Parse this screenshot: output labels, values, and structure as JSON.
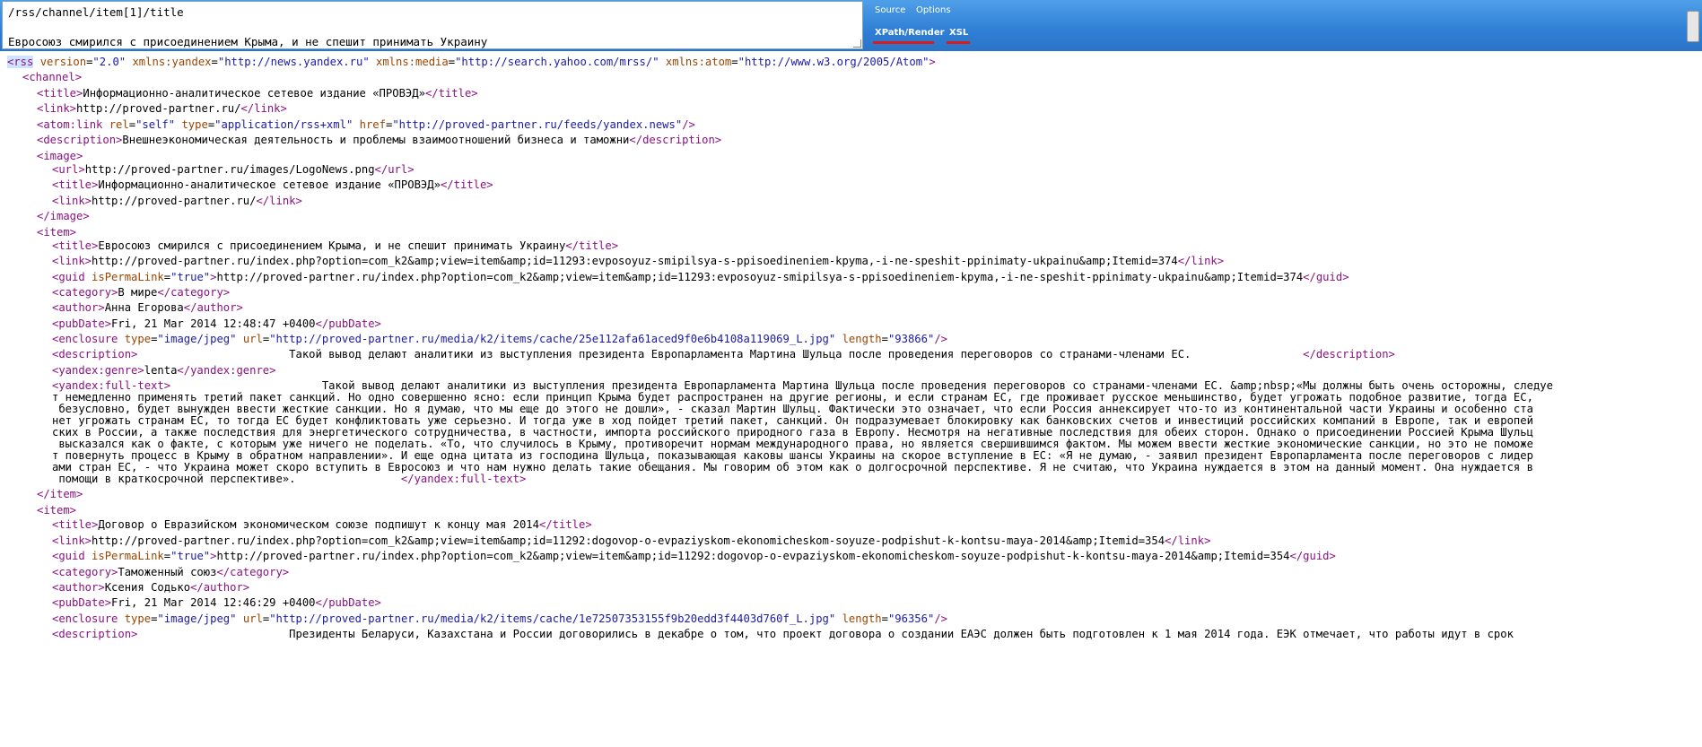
{
  "toolbar": {
    "xpath_query": "/rss/channel/item[1]/title",
    "xpath_result": "Евросоюз смирился с присоединением Крыма, и не спешит принимать Украину",
    "links": {
      "source": "Source",
      "options": "Options"
    },
    "tabs": {
      "xpath": "XPath/Render",
      "xsl": "XSL"
    }
  },
  "rss": {
    "version": "2.0",
    "ns_yandex": "http://news.yandex.ru",
    "ns_media": "http://search.yahoo.com/mrss/",
    "ns_atom": "http://www.w3.org/2005/Atom"
  },
  "channel": {
    "title": "Информационно-аналитическое сетевое издание «ПРОВЭД»",
    "link": "http://proved-partner.ru/",
    "atom_rel": "self",
    "atom_type": "application/rss+xml",
    "atom_href": "http://proved-partner.ru/feeds/yandex.news",
    "description": "Внешнеэкономическая деятельность и проблемы взаимоотношений бизнеса и таможни",
    "image": {
      "url": "http://proved-partner.ru/images/LogoNews.png",
      "title": "Информационно-аналитическое сетевое издание «ПРОВЭД»",
      "link": "http://proved-partner.ru/"
    }
  },
  "items": [
    {
      "title": "Евросоюз смирился с присоединением Крыма, и не спешит принимать Украину",
      "link": "http://proved-partner.ru/index.php?option=com_k2&amp;view=item&amp;id=11293:evposoyuz-smipilsya-s-ppisoedineniem-kpyma,-i-ne-speshit-ppinimaty-ukpainu&amp;Itemid=374",
      "guid_permalink": "true",
      "guid": "http://proved-partner.ru/index.php?option=com_k2&amp;view=item&amp;id=11293:evposoyuz-smipilsya-s-ppisoedineniem-kpyma,-i-ne-speshit-ppinimaty-ukpainu&amp;Itemid=374",
      "category": "В мире",
      "author": "Анна Егорова",
      "pubDate": "Fri, 21 Mar 2014 12:48:47 +0400",
      "enc_type": "image/jpeg",
      "enc_url": "http://proved-partner.ru/media/k2/items/cache/25e112afa61aced9f0e6b4108a119069_L.jpg",
      "enc_length": "93866",
      "description": "                       Такой вывод делают аналитики из выступления президента Европарламента Мартина Шульца после проведения переговоров со странами-членами ЕС.                 ",
      "fulltext_lines": [
        "                       Такой вывод делают аналитики из выступления президента Европарламента Мартина Шульца после проведения переговоров со странами-членами ЕС. &amp;nbsp;«Мы должны быть очень осторожны, следуе",
        "т немедленно применять третий пакет санкций. Но одно совершенно ясно: если принцип Крыма будет распространен на другие регионы, и если странам ЕС, где проживает русское меньшинство, будет угрожать подобное развитие, тогда ЕС,",
        " безусловно, будет вынужден ввести жесткие санкции. Но я думаю, что мы еще до этого не дошли», - сказал Мартин Шульц. Фактически это означает, что если Россия аннексирует что-то из континентальной части Украины и особенно ста",
        "нет угрожать странам ЕС, то тогда ЕС будет конфликтовать уже серьезно. И тогда уже в ход пойдет третий пакет, санкций. Он подразумевает блокировку как банковских счетов и инвестиций российских компаний в Европе, так и европей",
        "ских в России, а также последствия для энергетического сотрудничества, в частности, импорта российского природного газа в Европу. Несмотря на негативные последствия для обеих сторон. Однако о присоединении Россией Крыма Шульц",
        " высказался как о факте, с которым уже ничего не поделать. «То, что случилось в Крыму, противоречит нормам международного права, но является свершившимся фактом. Мы можем ввести жесткие экономические санкции, но это не поможе",
        "т повернуть процесс в Крыму в обратном направлении». И еще одна цитата из господина Шульца, показывающая каковы шансы Украины на скорое вступление в ЕС: «Я не думаю, - заявил президент Европарламента после переговоров с лидер",
        "ами стран ЕС, - что Украина может скоро вступить в Евросоюз и что нам нужно делать такие обещания. Мы говорим об этом как о долгосрочной перспективе. Я не считаю, что Украина нуждается в этом на данный момент. Она нуждается в",
        " помощи в краткосрочной перспективе».                "
      ]
    },
    {
      "title": "Договор о Евразийском экономическом союзе подпишут к концу мая 2014",
      "link": "http://proved-partner.ru/index.php?option=com_k2&amp;view=item&amp;id=11292:dogovop-o-evpaziyskom-ekonomicheskom-soyuze-podpishut-k-kontsu-maya-2014&amp;Itemid=354",
      "guid_permalink": "true",
      "guid": "http://proved-partner.ru/index.php?option=com_k2&amp;view=item&amp;id=11292:dogovop-o-evpaziyskom-ekonomicheskom-soyuze-podpishut-k-kontsu-maya-2014&amp;Itemid=354",
      "category": "Таможенный союз",
      "author": "Ксения Содько",
      "pubDate": "Fri, 21 Mar 2014 12:46:29 +0400",
      "enc_type": "image/jpeg",
      "enc_url": "http://proved-partner.ru/media/k2/items/cache/1e72507353155f9b20edd3f4403d760f_L.jpg",
      "enc_length": "96356",
      "description": "                       Президенты Беларуси, Казахстана и России договорились в декабре о том, что проект договора о создании ЕАЭС должен быть подготовлен к 1 мая 2014 года. ЕЭК отмечает, что работы идут в срок"
    }
  ]
}
